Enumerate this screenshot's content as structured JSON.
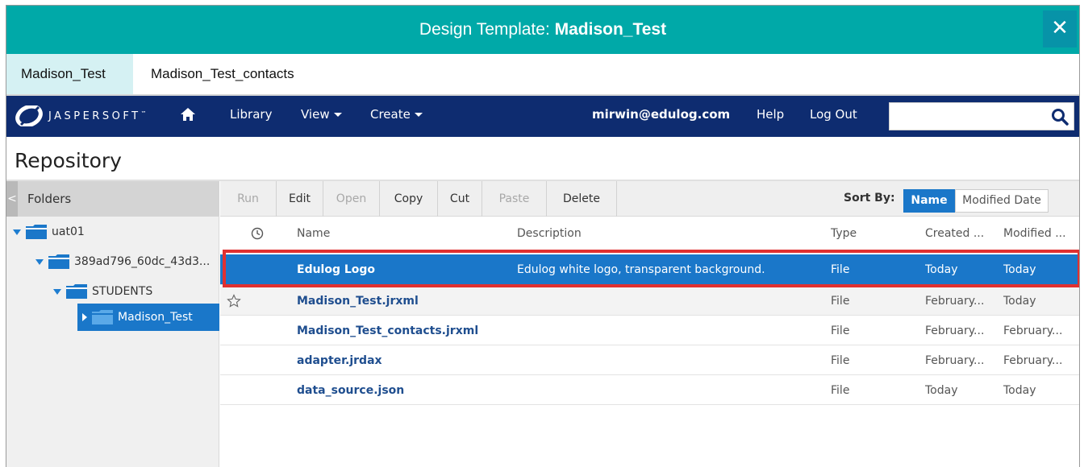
{
  "window": {
    "title_prefix": "Design Template: ",
    "title_name": "Madison_Test",
    "close_label": "✕"
  },
  "tabs": [
    {
      "label": "Madison_Test",
      "active": true
    },
    {
      "label": "Madison_Test_contacts",
      "active": false
    }
  ],
  "navbar": {
    "brand": "JASPERSOFT",
    "brand_tm": "™",
    "library": "Library",
    "view": "View",
    "create": "Create",
    "user": "mirwin@edulog.com",
    "help": "Help",
    "logout": "Log Out",
    "search_value": ""
  },
  "repository": {
    "title": "Repository",
    "folders_label": "Folders",
    "tree": [
      {
        "label": "uat01",
        "expanded": true
      },
      {
        "label": "389ad796_60dc_43d3...",
        "expanded": true
      },
      {
        "label": "STUDENTS",
        "expanded": true
      },
      {
        "label": "Madison_Test",
        "expanded": false,
        "selected": true
      }
    ]
  },
  "toolbar": {
    "buttons": [
      {
        "label": "Run",
        "enabled": false
      },
      {
        "label": "Edit",
        "enabled": true
      },
      {
        "label": "Open",
        "enabled": false
      },
      {
        "label": "Copy",
        "enabled": true
      },
      {
        "label": "Cut",
        "enabled": true
      },
      {
        "label": "Paste",
        "enabled": false
      },
      {
        "label": "Delete",
        "enabled": true
      }
    ],
    "sort_by_label": "Sort By:",
    "sort_name": "Name",
    "sort_modified": "Modified Date"
  },
  "table": {
    "headers": {
      "name": "Name",
      "description": "Description",
      "type": "Type",
      "created": "Created ...",
      "modified": "Modified ..."
    },
    "rows": [
      {
        "name": "Edulog Logo",
        "description": "Edulog white logo, transparent background.",
        "type": "File",
        "created": "Today",
        "modified": "Today",
        "selected": true
      },
      {
        "name": "Madison_Test.jrxml",
        "description": "",
        "type": "File",
        "created": "February...",
        "modified": "Today",
        "starred": true
      },
      {
        "name": "Madison_Test_contacts.jrxml",
        "description": "",
        "type": "File",
        "created": "February...",
        "modified": "February..."
      },
      {
        "name": "adapter.jrdax",
        "description": "",
        "type": "File",
        "created": "February...",
        "modified": "February..."
      },
      {
        "name": "data_source.json",
        "description": "",
        "type": "File",
        "created": "Today",
        "modified": "Today"
      }
    ]
  },
  "colors": {
    "title_bar": "#00a9a8",
    "nav_bar": "#0e2c70",
    "selection": "#1a77c9",
    "highlight_outline": "#e03030"
  }
}
